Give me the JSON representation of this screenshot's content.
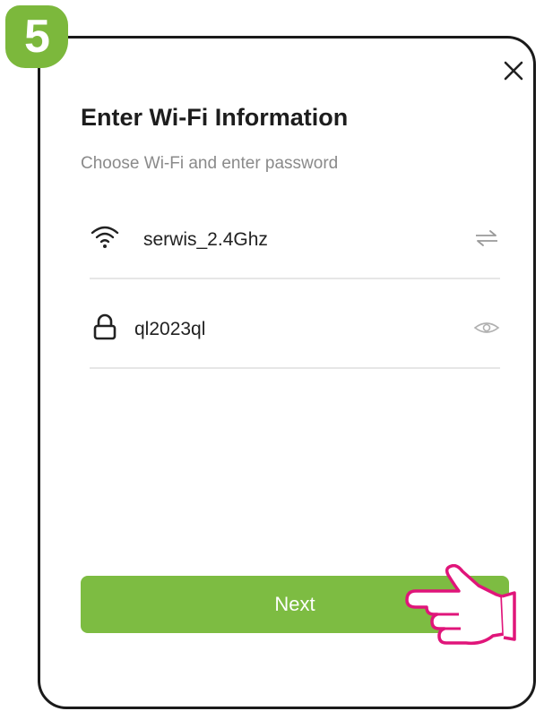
{
  "step": {
    "number": "5"
  },
  "dialog": {
    "title": "Enter Wi-Fi Information",
    "subtitle": "Choose Wi-Fi and enter password",
    "wifi": {
      "network_name": "serwis_2.4Ghz",
      "icon": "wifi-icon",
      "action_icon": "switch-network-icon"
    },
    "password": {
      "value": "ql2023ql",
      "icon": "lock-icon",
      "action_icon": "eye-icon"
    },
    "next_label": "Next",
    "close_icon": "close-icon"
  },
  "colors": {
    "accent": "#7dbc42",
    "badge": "#7cb83c",
    "pointer_outline": "#e0157a",
    "frame": "#1a1a1a"
  }
}
